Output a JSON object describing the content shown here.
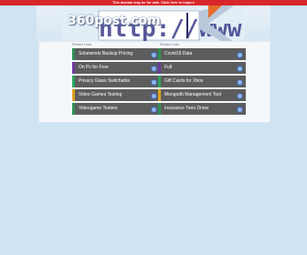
{
  "notice": "This domain may be for sale. Click here to inquire",
  "logo_text": "360post.com",
  "column_headers": [
    "Related Links",
    "Related Links"
  ],
  "left_links": [
    {
      "label": "Solarwinds Backup Pricing",
      "accent": "#2f8f55"
    },
    {
      "label": "On Pc for Free",
      "accent": "#6b3aa0"
    },
    {
      "label": "Privacy Glass Switchable",
      "accent": "#2aa55d"
    },
    {
      "label": "Video Games Testing",
      "accent": "#e0a020"
    },
    {
      "label": "Videogame Testers",
      "accent": "#2f8f55"
    }
  ],
  "right_links": [
    {
      "label": "Covid19 Data",
      "accent": "#2f8f55"
    },
    {
      "label": "Full",
      "accent": "#6b3aa0"
    },
    {
      "label": "Gift Cards for Xbox",
      "accent": "#2aa55d"
    },
    {
      "label": "Mongodb Management Tool",
      "accent": "#e0a020"
    },
    {
      "label": "Insurance Teen Driver",
      "accent": "#2f8f55"
    }
  ],
  "icons": {
    "link_arrow": "circle-arrow-icon",
    "banner": "browser-url-banner"
  }
}
